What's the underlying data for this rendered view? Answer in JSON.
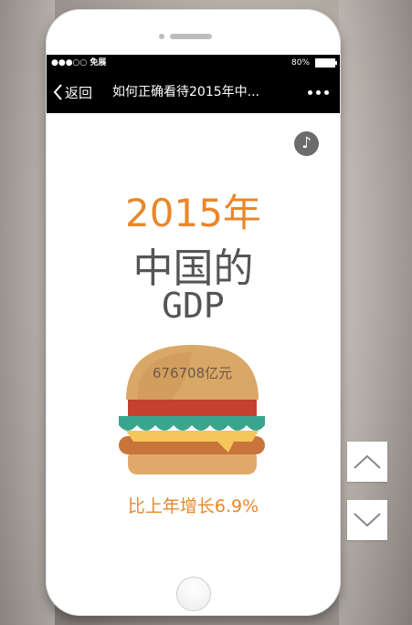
{
  "status_bar": {
    "signal": "●●●○○ 免展",
    "battery": "80%"
  },
  "nav": {
    "back_label": "返回",
    "title": "如何正确看待2015年中..."
  },
  "content": {
    "year_title": "2015年",
    "country_title": "中国的",
    "gdp_title": "GDP",
    "gdp_value": "676708亿元",
    "growth_text": "比上年增长6.9%"
  },
  "icons": {
    "music": "music-note-icon",
    "up": "chevron-up-icon",
    "down": "chevron-down-icon"
  },
  "colors": {
    "accent": "#e8872b",
    "text_gray": "#555555",
    "navbar": "#000000"
  }
}
